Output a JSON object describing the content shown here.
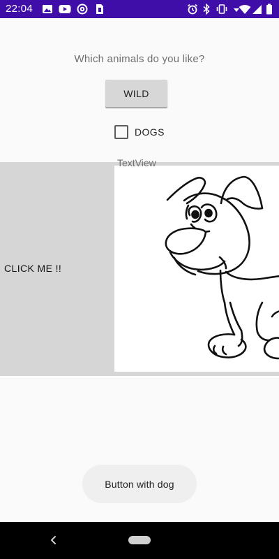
{
  "status_bar": {
    "time": "22:04",
    "background_color": "#3f0ea8",
    "left_icons": [
      "photo-icon",
      "youtube-icon",
      "at-sign-icon",
      "sim-icon"
    ],
    "right_icons": [
      "alarm-icon",
      "bluetooth-icon",
      "vibrate-icon",
      "wifi-signal-icon",
      "wifi-icon",
      "cell-signal-icon",
      "battery-icon"
    ]
  },
  "main": {
    "question": "Which animals do you like?",
    "wild_button_label": "WILD",
    "checkbox": {
      "label": "DOGS",
      "checked": false
    },
    "textview_label": "TextView",
    "click_me_label": "CLICK ME !!",
    "dog_image_icon": "dog-cartoon-image",
    "dog_button_label": "Button with dog"
  },
  "nav_bar": {
    "back_icon": "back-chevron-icon",
    "home_icon": "home-pill-icon"
  }
}
